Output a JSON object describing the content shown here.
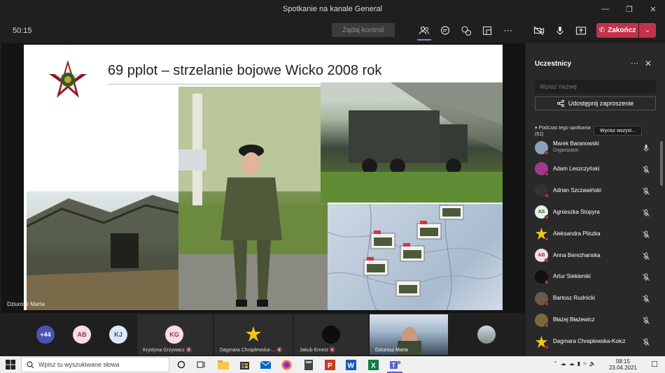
{
  "window": {
    "title": "Spotkanie na kanale General"
  },
  "toolbar": {
    "timer": "50:15",
    "request_control": "Żądaj kontroli",
    "leave_label": "Zakończ"
  },
  "slide": {
    "title": "69 pplot – strzelanie bojowe Wicko 2008 rok"
  },
  "presenter": {
    "name": "Dziurosz Marta"
  },
  "sidebar": {
    "title": "Uczestnicy",
    "search_placeholder": "Wpisz nazwę",
    "share_label": "Udostępnij zaproszenie",
    "during_label": "Podczas tego spotkania",
    "during_count": "(51)",
    "mute_all": "Wycisz wszyst...",
    "participants": [
      {
        "name": "Marek Baranowski",
        "role": "Organizator",
        "initials": "",
        "bg": "#8aa0b8"
      },
      {
        "name": "Adam Leszczyński",
        "role": "",
        "initials": "",
        "bg": "#a03a8c"
      },
      {
        "name": "Adrian Szczawiński",
        "role": "",
        "initials": "",
        "bg": "#333333"
      },
      {
        "name": "Agnieszka Stopyra",
        "role": "",
        "initials": "AS",
        "bg": "#e9f0e6"
      },
      {
        "name": "Aleksandra Pliszka",
        "role": "",
        "initials": "",
        "bg": "#292929"
      },
      {
        "name": "Anna Berezhanska",
        "role": "",
        "initials": "AB",
        "bg": "#f7dde4"
      },
      {
        "name": "Artur Siekierski",
        "role": "",
        "initials": "",
        "bg": "#111111"
      },
      {
        "name": "Bartosz Rudnicki",
        "role": "",
        "initials": "",
        "bg": "#6a5a4a"
      },
      {
        "name": "Błażej Błażewicz",
        "role": "",
        "initials": "",
        "bg": "#7a6a3a"
      },
      {
        "name": "Dagmara Chraplewska-Kołcz",
        "role": "",
        "initials": "",
        "bg": "#292929"
      }
    ]
  },
  "gallery": {
    "overflow": "+44",
    "circles": [
      {
        "initials": "AB",
        "bg": "#f7dde4",
        "fg": "#8a3a55"
      },
      {
        "initials": "KJ",
        "bg": "#dce8f7",
        "fg": "#2a4a7a"
      }
    ],
    "tiles": [
      {
        "name": "Krystyna Grzywacz",
        "initials": "KG"
      },
      {
        "name": "Dagmara Chraplewska-...",
        "initials": ""
      },
      {
        "name": "Jakub Ernest",
        "initials": ""
      },
      {
        "name": "Dziurosz Marta",
        "initials": ""
      }
    ]
  },
  "taskbar": {
    "search_placeholder": "Wpisz tu wyszukiwane słowa",
    "time": "08:15",
    "date": "23.04.2021"
  },
  "colors": {
    "accent_red": "#c4314b",
    "dark_bg": "#1f1f1f",
    "panel_bg": "#292929"
  }
}
